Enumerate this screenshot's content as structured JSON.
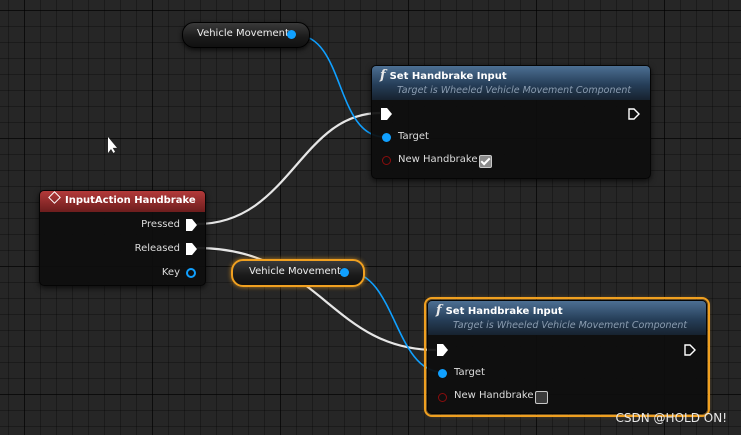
{
  "nodes": {
    "vehicle_movement_top": {
      "label": "Vehicle Movement"
    },
    "set_handbrake_top": {
      "title": "Set Handbrake Input",
      "subtitle": "Target is Wheeled Vehicle Movement Component",
      "target_label": "Target",
      "param_label": "New Handbrake",
      "param_checked": true
    },
    "input_action": {
      "title": "InputAction Handbrake",
      "pressed_label": "Pressed",
      "released_label": "Released",
      "key_label": "Key"
    },
    "vehicle_movement_bottom": {
      "label": "Vehicle Movement"
    },
    "set_handbrake_bottom": {
      "title": "Set Handbrake Input",
      "subtitle": "Target is Wheeled Vehicle Movement Component",
      "target_label": "Target",
      "param_label": "New Handbrake",
      "param_checked": false
    }
  },
  "colors": {
    "exec_wire": "#e6e6e6",
    "object_pin": "#10a0ff",
    "bool_pin": "#8a0d0d",
    "selection": "#f0a020",
    "event_header": "#b33a3a",
    "function_header": "#4c6f93"
  },
  "watermark": "CSDN @HOLD ON!"
}
